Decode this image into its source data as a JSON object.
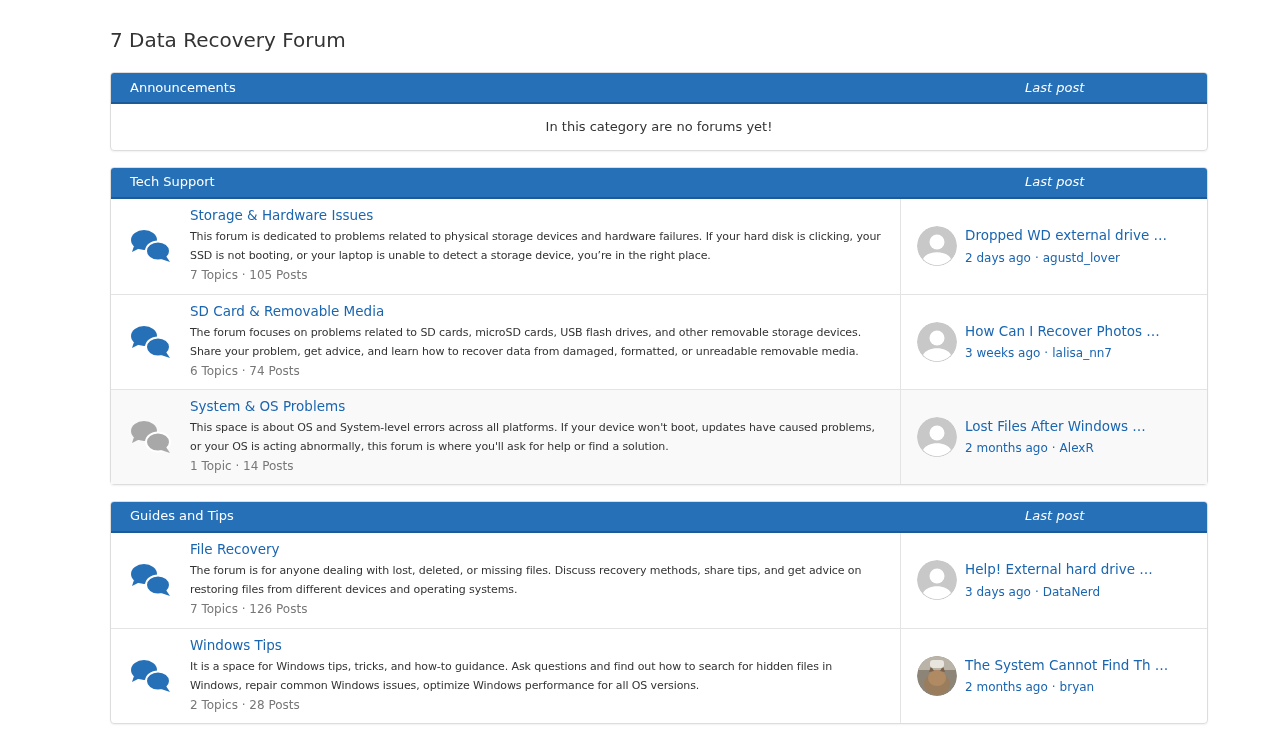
{
  "page_title": "7 Data Recovery Forum",
  "categories": [
    {
      "name": "Announcements",
      "last_post_label": "Last post",
      "empty_message": "In this category are no forums yet!"
    },
    {
      "name": "Tech Support",
      "last_post_label": "Last post",
      "forums": [
        {
          "title": "Storage & Hardware Issues",
          "description": "This forum is dedicated to problems related to physical storage devices and hardware failures. If your hard disk is clicking, your SSD is not booting, or your laptop is unable to detect a storage device, you’re in the right place.",
          "stats": "7 Topics · 105 Posts",
          "unread": true,
          "last_post": {
            "title": "Dropped WD external drive …",
            "time": "2 days ago",
            "separator": "·",
            "author": "agustd_lover",
            "has_photo": false
          }
        },
        {
          "title": "SD Card & Removable Media",
          "description": "The forum focuses on problems related to SD cards, microSD cards, USB flash drives, and other removable storage devices. Share your problem, get advice, and learn how to recover data from damaged, formatted, or unreadable removable media.",
          "stats": "6 Topics · 74 Posts",
          "unread": true,
          "last_post": {
            "title": "How Can I Recover Photos …",
            "time": "3 weeks ago",
            "separator": "·",
            "author": "lalisa_nn7",
            "has_photo": false
          }
        },
        {
          "title": "System & OS Problems",
          "description": "This space is about OS and System-level errors across all platforms. If your device won't boot, updates have caused problems, or your OS is acting abnormally, this forum is where you'll ask for help or find a solution.",
          "stats": "1 Topic · 14 Posts",
          "unread": false,
          "last_post": {
            "title": "Lost Files After Windows …",
            "time": "2 months ago",
            "separator": "·",
            "author": "AlexR",
            "has_photo": false
          }
        }
      ]
    },
    {
      "name": "Guides and Tips",
      "last_post_label": "Last post",
      "forums": [
        {
          "title": "File Recovery",
          "description": "The forum is for anyone dealing with lost, deleted, or missing files. Discuss recovery methods, share tips, and get advice on restoring files from different devices and operating systems.",
          "stats": "7 Topics · 126 Posts",
          "unread": true,
          "last_post": {
            "title": "Help! External hard drive …",
            "time": "3 days ago",
            "separator": "·",
            "author": "DataNerd",
            "has_photo": false
          }
        },
        {
          "title": "Windows Tips",
          "description": "It is a space for Windows tips, tricks, and how-to guidance. Ask questions and find out how to search for hidden files in Windows, repair common Windows issues, optimize Windows performance for all OS versions.",
          "stats": "2 Topics · 28 Posts",
          "unread": true,
          "last_post": {
            "title": "The System Cannot Find Th …",
            "time": "2 months ago",
            "separator": "·",
            "author": "bryan",
            "has_photo": true
          }
        }
      ]
    }
  ]
}
